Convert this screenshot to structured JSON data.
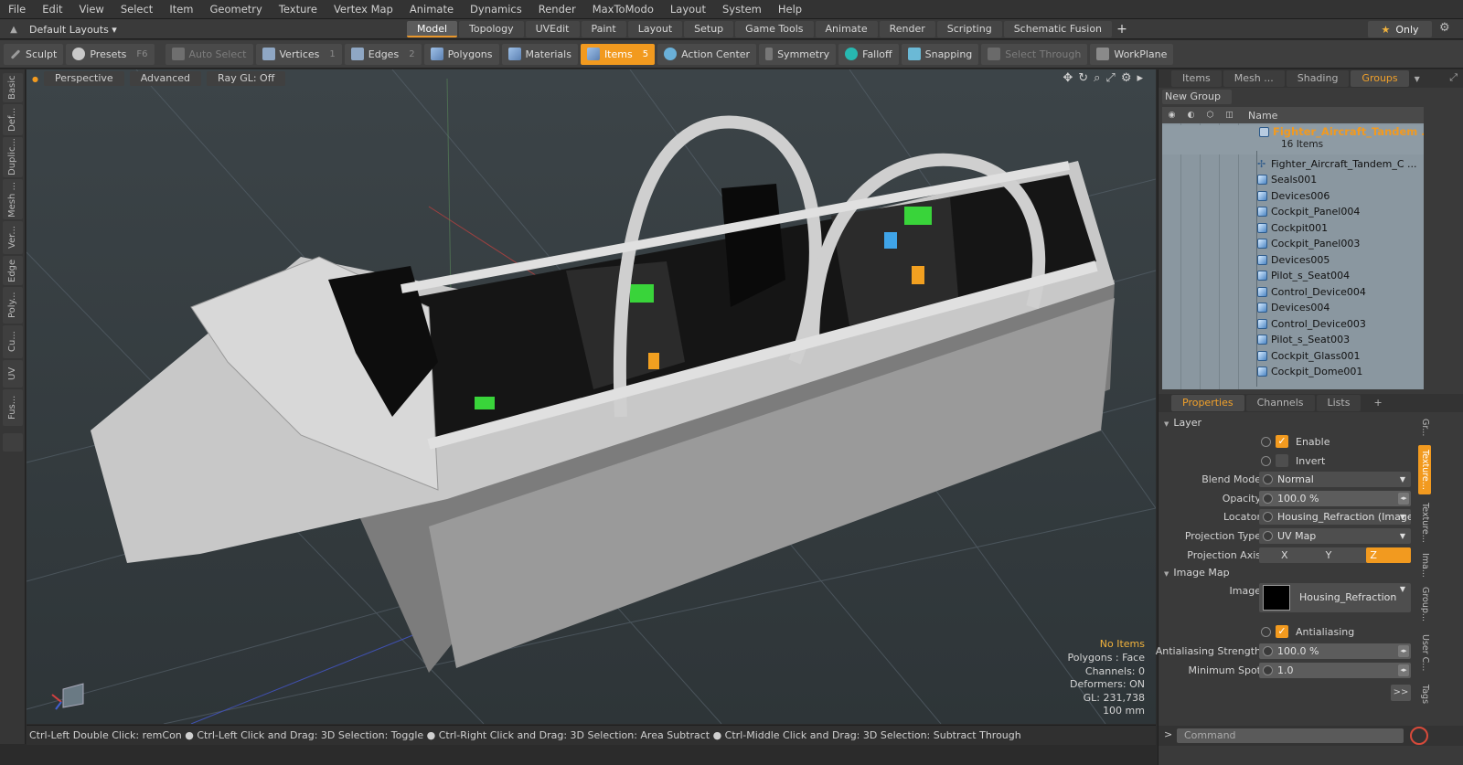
{
  "menu": [
    "File",
    "Edit",
    "View",
    "Select",
    "Item",
    "Geometry",
    "Texture",
    "Vertex Map",
    "Animate",
    "Dynamics",
    "Render",
    "MaxToModo",
    "Layout",
    "System",
    "Help"
  ],
  "layout": {
    "selector": "Default Layouts ▾",
    "tabs": [
      "Model",
      "Topology",
      "UVEdit",
      "Paint",
      "Layout",
      "Setup",
      "Game Tools",
      "Animate",
      "Render",
      "Scripting",
      "Schematic Fusion"
    ],
    "active_tab": "Model",
    "add": "+",
    "only": "Only"
  },
  "toolbar": {
    "sculpt": "Sculpt",
    "presets": "Presets",
    "presets_key": "F6",
    "auto_select": "Auto Select",
    "vertices": "Vertices",
    "vertices_key": "1",
    "edges": "Edges",
    "edges_key": "2",
    "polygons": "Polygons",
    "materials": "Materials",
    "items": "Items",
    "items_key": "5",
    "action_center": "Action Center",
    "symmetry": "Symmetry",
    "falloff": "Falloff",
    "snapping": "Snapping",
    "select_through": "Select Through",
    "workplane": "WorkPlane"
  },
  "left_tabs": [
    "Basic",
    "Def...",
    "Duplic...",
    "Mesh ...",
    "Ver...",
    "Edge",
    "Poly...",
    "Cu...",
    "UV",
    "Fus..."
  ],
  "viewport": {
    "perspective": "Perspective",
    "advanced": "Advanced",
    "raygl": "Ray GL: Off",
    "info": {
      "no_items": "No Items",
      "polygons": "Polygons : Face",
      "channels": "Channels: 0",
      "deformers": "Deformers: ON",
      "gl": "GL: 231,738",
      "unit": "100 mm"
    }
  },
  "status": "Ctrl-Left Double Click: remCon ● Ctrl-Left Click and Drag: 3D Selection: Toggle ● Ctrl-Right Click and Drag: 3D Selection: Area Subtract ● Ctrl-Middle Click and Drag: 3D Selection: Subtract Through",
  "panel_tabs": [
    "Items",
    "Mesh ...",
    "Shading",
    "Groups"
  ],
  "panel_active": "Groups",
  "groups": {
    "new_group": "New Group",
    "name_header": "Name",
    "group_name": "Fighter_Aircraft_Tandem ...",
    "group_count": "16 Items",
    "items": [
      {
        "name": "Fighter_Aircraft_Tandem_C ...",
        "icon": "locator-icon"
      },
      {
        "name": "Seals001",
        "icon": "mesh-icon"
      },
      {
        "name": "Devices006",
        "icon": "mesh-icon"
      },
      {
        "name": "Cockpit_Panel004",
        "icon": "mesh-icon"
      },
      {
        "name": "Cockpit001",
        "icon": "mesh-icon"
      },
      {
        "name": "Cockpit_Panel003",
        "icon": "mesh-icon"
      },
      {
        "name": "Devices005",
        "icon": "mesh-icon"
      },
      {
        "name": "Pilot_s_Seat004",
        "icon": "mesh-icon"
      },
      {
        "name": "Control_Device004",
        "icon": "mesh-icon"
      },
      {
        "name": "Devices004",
        "icon": "mesh-icon"
      },
      {
        "name": "Control_Device003",
        "icon": "mesh-icon"
      },
      {
        "name": "Pilot_s_Seat003",
        "icon": "mesh-icon"
      },
      {
        "name": "Cockpit_Glass001",
        "icon": "mesh-icon"
      },
      {
        "name": "Cockpit_Dome001",
        "icon": "mesh-icon"
      }
    ]
  },
  "prop_tabs": [
    "Properties",
    "Channels",
    "Lists",
    "+"
  ],
  "prop_active": "Properties",
  "properties": {
    "layer_section": "Layer",
    "enable": "Enable",
    "invert": "Invert",
    "blend_mode_label": "Blend Mode",
    "blend_mode": "Normal",
    "opacity_label": "Opacity",
    "opacity": "100.0 %",
    "locator_label": "Locator",
    "locator": "Housing_Refraction (Image)",
    "projection_type_label": "Projection Type",
    "projection_type": "UV Map",
    "projection_axis_label": "Projection Axis",
    "axes": [
      "X",
      "Y",
      "Z"
    ],
    "axis_active": "Z",
    "image_map_section": "Image Map",
    "image_label": "Image",
    "image": "Housing_Refraction",
    "antialiasing": "Antialiasing",
    "aa_strength_label": "Antialiasing Strength",
    "aa_strength": "100.0 %",
    "min_spot_label": "Minimum Spot",
    "min_spot": "1.0",
    "more": ">>"
  },
  "prop_vtabs": [
    "Gr...",
    "Texture...",
    "Texture...",
    "Ima...",
    "Group...",
    "User C...",
    "Tags"
  ],
  "command_placeholder": "Command",
  "colors": {
    "accent": "#f29a1f",
    "group_title": "#f29a1f",
    "list_bg": "#8a97a0"
  }
}
